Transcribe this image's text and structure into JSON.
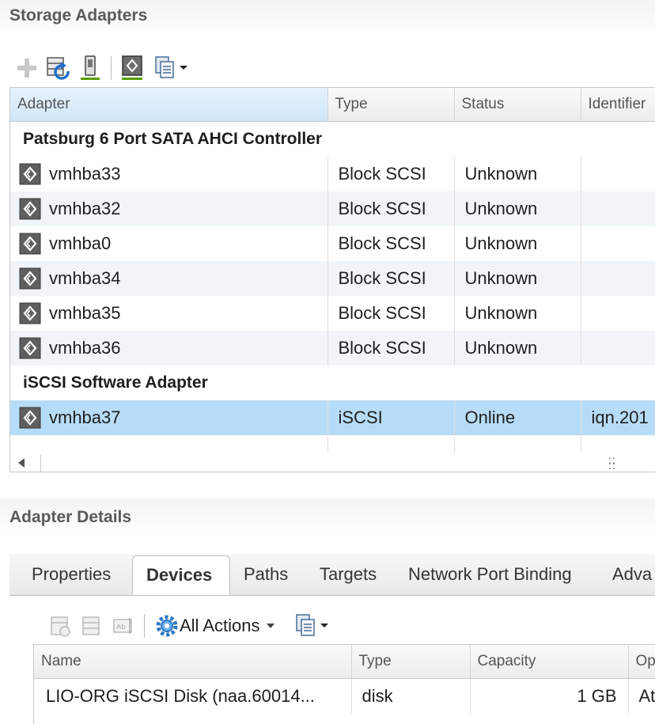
{
  "storage_adapters": {
    "title": "Storage Adapters",
    "toolbar": [
      {
        "icon": "add-icon",
        "enabled": false
      },
      {
        "icon": "rescan-storage-icon",
        "enabled": true
      },
      {
        "icon": "rescan-adapter-icon",
        "enabled": true
      },
      {
        "icon": "adapter-settings-icon",
        "enabled": true
      },
      {
        "icon": "export-list-icon",
        "enabled": true
      }
    ],
    "columns": [
      "Adapter",
      "Type",
      "Status",
      "Identifier"
    ],
    "groups": [
      {
        "name": "Patsburg 6 Port SATA AHCI Controller",
        "rows": [
          {
            "adapter": "vmhba33",
            "type": "Block SCSI",
            "status": "Unknown",
            "identifier": ""
          },
          {
            "adapter": "vmhba32",
            "type": "Block SCSI",
            "status": "Unknown",
            "identifier": ""
          },
          {
            "adapter": "vmhba0",
            "type": "Block SCSI",
            "status": "Unknown",
            "identifier": ""
          },
          {
            "adapter": "vmhba34",
            "type": "Block SCSI",
            "status": "Unknown",
            "identifier": ""
          },
          {
            "adapter": "vmhba35",
            "type": "Block SCSI",
            "status": "Unknown",
            "identifier": ""
          },
          {
            "adapter": "vmhba36",
            "type": "Block SCSI",
            "status": "Unknown",
            "identifier": ""
          }
        ]
      },
      {
        "name": "iSCSI Software Adapter",
        "rows": [
          {
            "adapter": "vmhba37",
            "type": "iSCSI",
            "status": "Online",
            "identifier": "iqn.201"
          }
        ]
      }
    ]
  },
  "adapter_details": {
    "title": "Adapter Details",
    "tabs": [
      "Properties",
      "Devices",
      "Paths",
      "Targets",
      "Network Port Binding",
      "Adva"
    ],
    "active_tab": "Devices",
    "toolbar": {
      "all_actions_label": "All Actions"
    },
    "columns": [
      "Name",
      "Type",
      "Capacity",
      "Op"
    ],
    "rows": [
      {
        "name": "LIO-ORG iSCSI Disk (naa.60014...",
        "type": "disk",
        "capacity": "1 GB",
        "op": "At"
      }
    ]
  },
  "colors": {
    "selected_row": "#b7dcf7",
    "sorted_header": "#cfe6f8",
    "alt_row": "#f1f5f8",
    "title_text": "#5a5a5a"
  }
}
